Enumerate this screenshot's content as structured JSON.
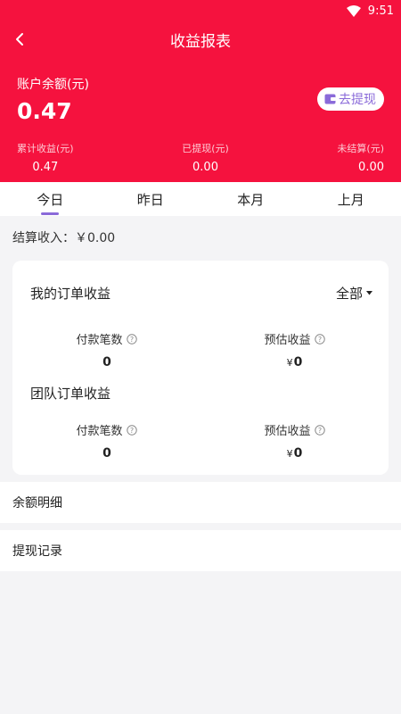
{
  "status_bar": {
    "time": "9:51"
  },
  "header": {
    "title": "收益报表",
    "balance_label": "账户余额(元)",
    "balance_value": "0.47",
    "withdraw_label": "去提现",
    "stats": [
      {
        "label": "累计收益(元)",
        "value": "0.47"
      },
      {
        "label": "已提现(元)",
        "value": "0.00"
      },
      {
        "label": "未结算(元)",
        "value": "0.00"
      }
    ]
  },
  "tabs": [
    {
      "label": "今日",
      "active": true
    },
    {
      "label": "昨日",
      "active": false
    },
    {
      "label": "本月",
      "active": false
    },
    {
      "label": "上月",
      "active": false
    }
  ],
  "settlement": {
    "text": "结算收入：￥0.00"
  },
  "my_orders": {
    "title": "我的订单收益",
    "filter_label": "全部",
    "metrics": [
      {
        "label": "付款笔数",
        "value": "0",
        "currency": ""
      },
      {
        "label": "预估收益",
        "value": "0",
        "currency": "¥"
      }
    ]
  },
  "team_orders": {
    "title": "团队订单收益",
    "metrics": [
      {
        "label": "付款笔数",
        "value": "0",
        "currency": ""
      },
      {
        "label": "预估收益",
        "value": "0",
        "currency": "¥"
      }
    ]
  },
  "links": {
    "balance_detail": "余额明细",
    "withdraw_records": "提现记录"
  },
  "colors": {
    "brand": "#f5123e",
    "accent": "#8a6ad9"
  }
}
